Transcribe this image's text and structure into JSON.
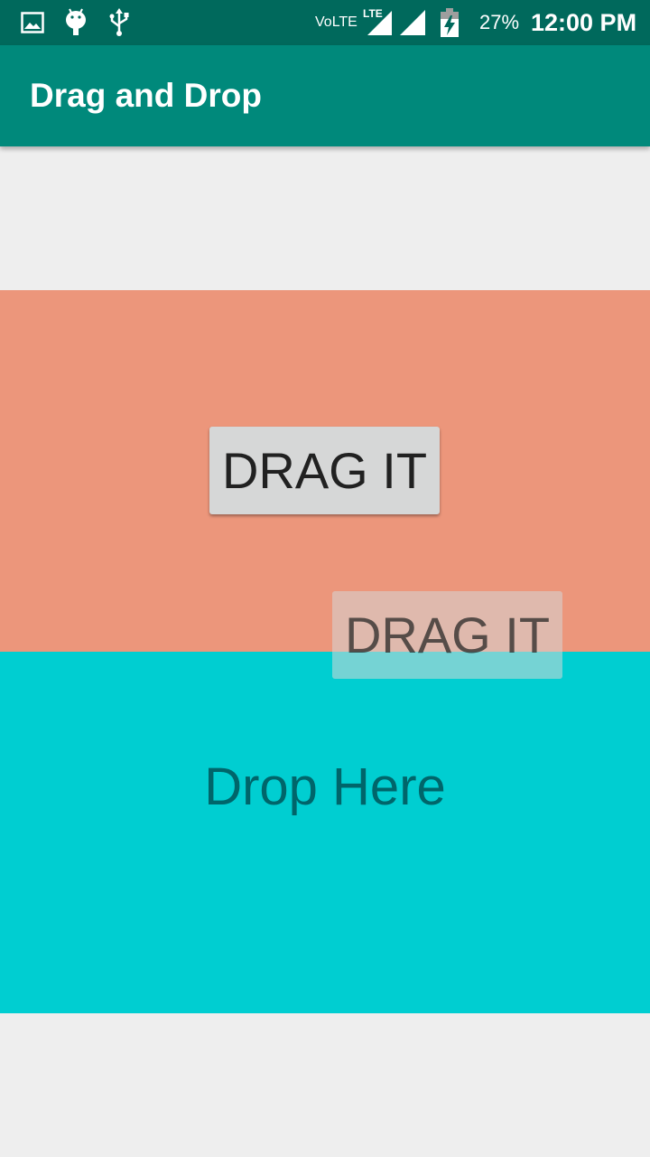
{
  "status_bar": {
    "network_label": "VoLTE",
    "lte_label": "LTE",
    "battery_percent": "27%",
    "time": "12:00 PM",
    "icons": [
      "gallery-icon",
      "android-icon",
      "usb-icon",
      "lte-signal-icon",
      "signal-icon",
      "battery-charging-icon"
    ]
  },
  "app_bar": {
    "title": "Drag and Drop",
    "color": "#00897b"
  },
  "drag_area": {
    "color": "#ec967b",
    "button_label": "DRAG IT",
    "drag_shadow_label": "DRAG IT"
  },
  "drop_area": {
    "color": "#00ced1",
    "label": "Drop Here"
  }
}
